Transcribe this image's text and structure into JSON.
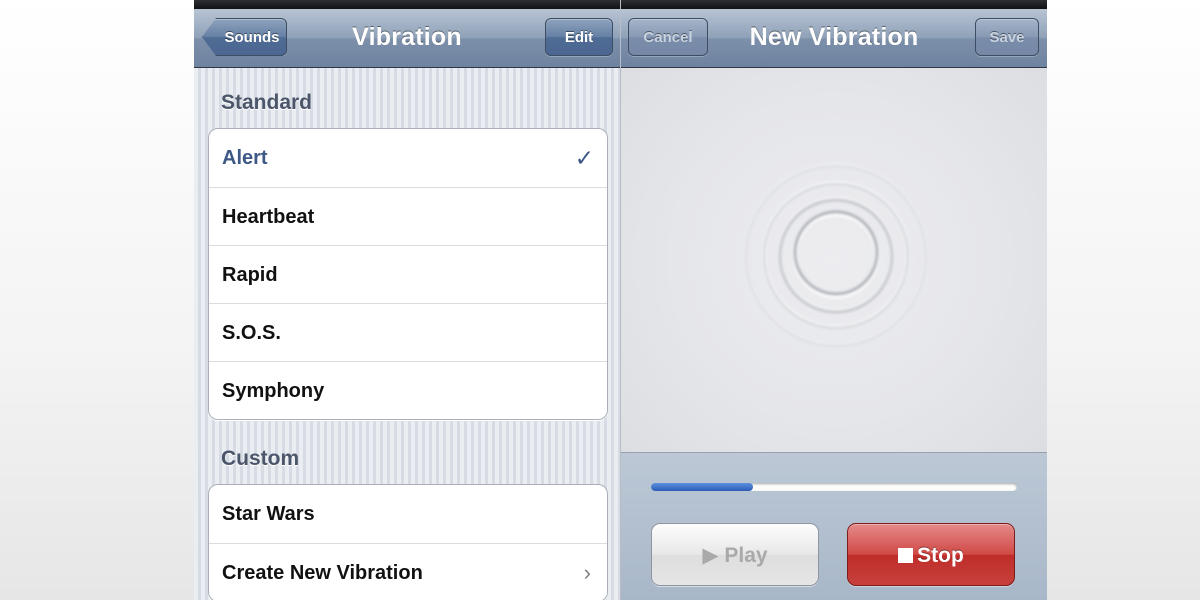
{
  "left_screen": {
    "navbar": {
      "back_label": "Sounds",
      "title": "Vibration",
      "edit_label": "Edit"
    },
    "standard": {
      "header": "Standard",
      "items": [
        {
          "label": "Alert",
          "selected": true,
          "accessory": "checkmark-icon"
        },
        {
          "label": "Heartbeat"
        },
        {
          "label": "Rapid"
        },
        {
          "label": "S.O.S."
        },
        {
          "label": "Symphony"
        }
      ]
    },
    "custom": {
      "header": "Custom",
      "items": [
        {
          "label": "Star Wars"
        },
        {
          "label": "Create New Vibration",
          "accessory": "chevron-right-icon"
        }
      ]
    }
  },
  "right_screen": {
    "navbar": {
      "cancel_label": "Cancel",
      "title": "New Vibration",
      "save_label": "Save"
    },
    "recording_progress": 0.28,
    "play_label": "Play",
    "stop_label": "Stop"
  },
  "colors": {
    "navbar_accent": "#6e83a0",
    "selected_text": "#3e5886",
    "stop_button": "#c7403c",
    "progress_fill": "#2a5cb6"
  }
}
